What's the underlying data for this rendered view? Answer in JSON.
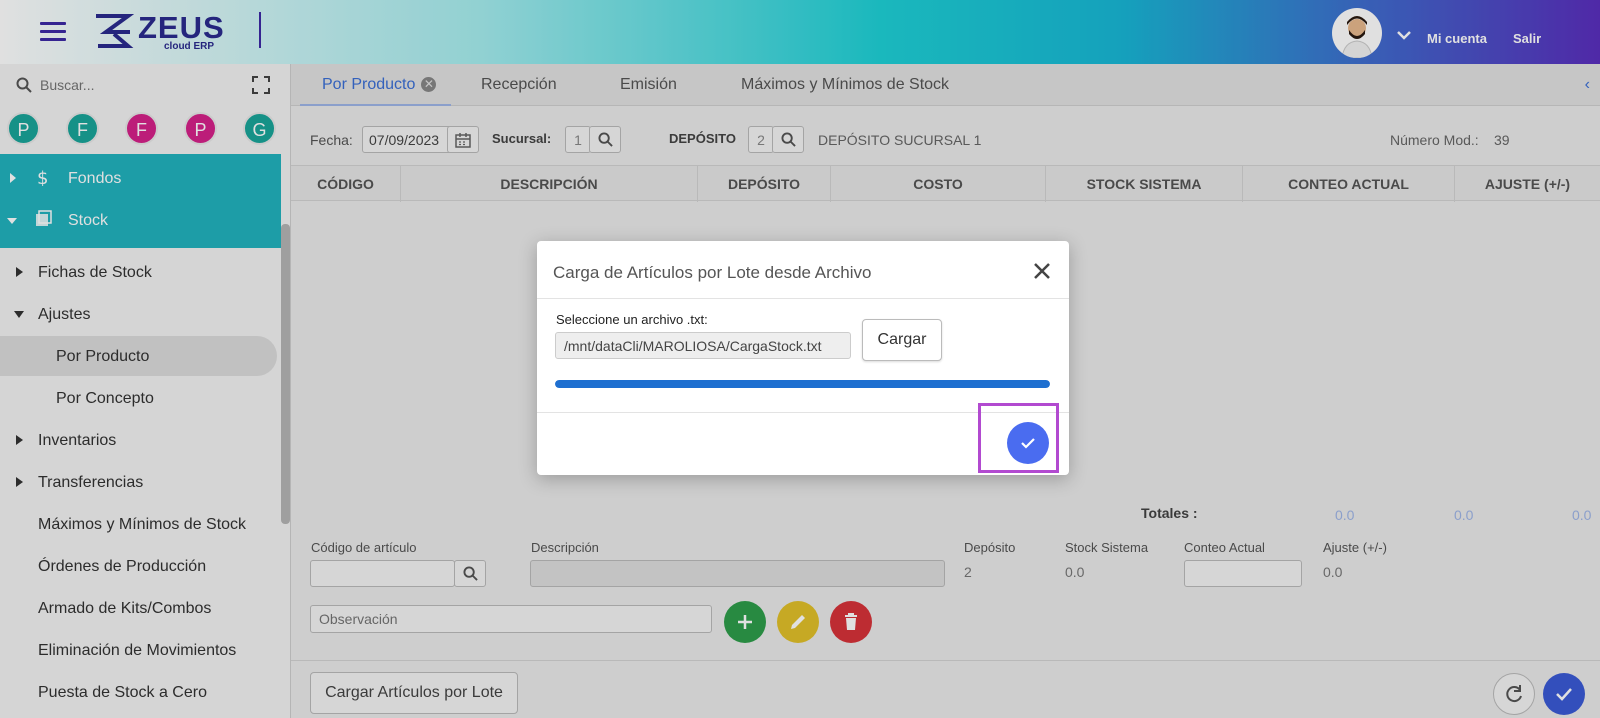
{
  "header": {
    "logo_text": "ZEUS",
    "logo_sub": "cloud ERP",
    "account_label": "Mi cuenta",
    "logout_label": "Salir"
  },
  "sidebar": {
    "search_placeholder": "Buscar...",
    "quick_circles": [
      {
        "letter": "P",
        "color": "#1aa59a"
      },
      {
        "letter": "F",
        "color": "#1aa59a"
      },
      {
        "letter": "F",
        "color": "#d6218a"
      },
      {
        "letter": "P",
        "color": "#d6218a"
      },
      {
        "letter": "G",
        "color": "#1aa59a"
      }
    ],
    "modules": [
      {
        "label": "Fondos",
        "icon": "dollar-icon"
      },
      {
        "label": "Stock",
        "icon": "cube-icon"
      }
    ],
    "items": [
      {
        "label": "Fichas de Stock",
        "caret": "right"
      },
      {
        "label": "Ajustes",
        "caret": "down"
      },
      {
        "label": "Por Producto",
        "sub": true,
        "active": true
      },
      {
        "label": "Por Concepto",
        "sub": true
      },
      {
        "label": "Inventarios",
        "caret": "right"
      },
      {
        "label": "Transferencias",
        "caret": "right"
      },
      {
        "label": "Máximos y Mínimos de Stock"
      },
      {
        "label": "Órdenes de Producción"
      },
      {
        "label": "Armado de Kits/Combos"
      },
      {
        "label": "Eliminación de Movimientos"
      },
      {
        "label": "Puesta de Stock a Cero"
      }
    ]
  },
  "tabs": [
    {
      "label": "Por Producto",
      "active": true
    },
    {
      "label": "Recepción"
    },
    {
      "label": "Emisión"
    },
    {
      "label": "Máximos y Mínimos de Stock"
    }
  ],
  "filters": {
    "fecha_label": "Fecha:",
    "fecha_value": "07/09/2023",
    "sucursal_label": "Sucursal:",
    "sucursal_value": "1",
    "deposito_label": "DEPÓSITO",
    "deposito_value": "2",
    "deposito_name": "DEPÓSITO SUCURSAL 1",
    "numero_label": "Número Mod.:",
    "numero_value": "39"
  },
  "table": {
    "columns": [
      "CÓDIGO",
      "DESCRIPCIÓN",
      "DEPÓSITO",
      "COSTO",
      "STOCK SISTEMA",
      "CONTEO ACTUAL",
      "AJUSTE (+/-)"
    ]
  },
  "totals": {
    "label": "Totales :",
    "values": [
      "0.0",
      "0.0",
      "0.0"
    ]
  },
  "form": {
    "codigo_label": "Código de artículo",
    "descripcion_label": "Descripción",
    "deposito_label": "Depósito",
    "deposito_value": "2",
    "stock_label": "Stock Sistema",
    "stock_value": "0.0",
    "conteo_label": "Conteo Actual",
    "ajuste_label": "Ajuste (+/-)",
    "ajuste_value": "0.0",
    "observacion_placeholder": "Observación"
  },
  "footer": {
    "lote_button": "Cargar Artículos por Lote"
  },
  "dialog": {
    "title": "Carga de Artículos por Lote desde Archivo",
    "file_label": "Seleccione un archivo .txt:",
    "file_value": "/mnt/dataCli/MAROLIOSA/CargaStock.txt",
    "upload_button": "Cargar",
    "progress": 1.0
  },
  "colors": {
    "accent": "#21b3bf",
    "primary": "#3b5bd6",
    "add": "#2e9e4a",
    "edit": "#e2c12a",
    "delete": "#d8333a",
    "highlight": "#b24ad0"
  }
}
